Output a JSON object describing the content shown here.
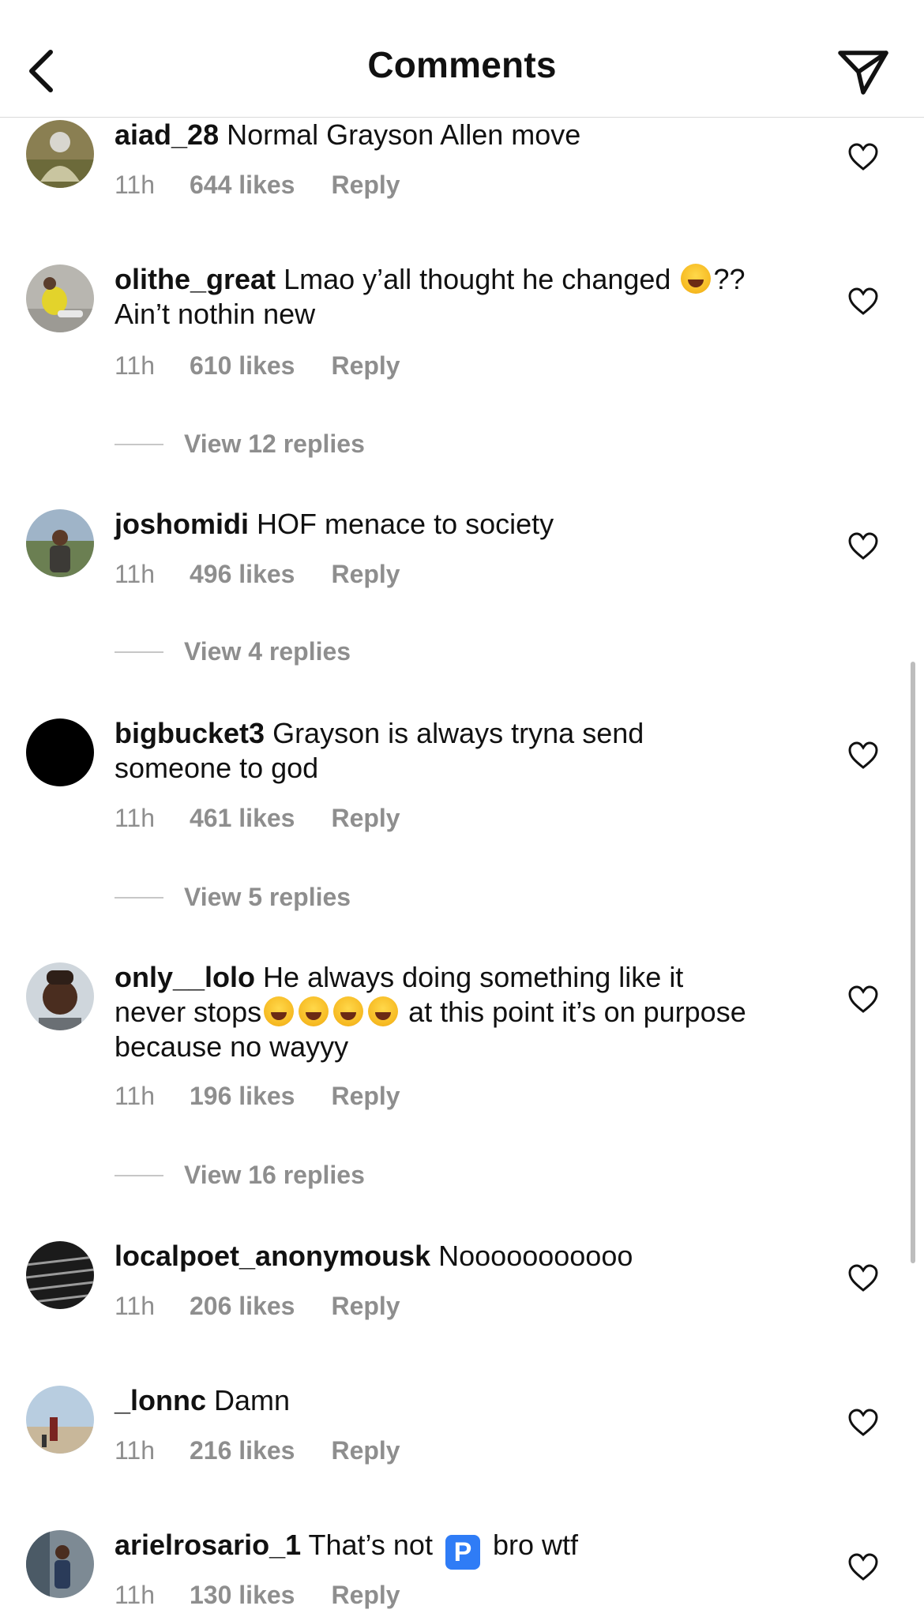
{
  "header": {
    "title": "Comments"
  },
  "comments": [
    {
      "username": "aiad_28",
      "text": "Normal Grayson Allen move",
      "time": "11h",
      "likes": "644 likes",
      "reply": "Reply"
    },
    {
      "username": "olithe_great",
      "text_before_emoji": "Lmao y’all thought he changed ",
      "text_after_emoji": "?? Ain’t nothin new",
      "emoji": "face-with-tears-of-joy",
      "time": "11h",
      "likes": "610 likes",
      "reply": "Reply",
      "view_replies": "View 12 replies"
    },
    {
      "username": "joshomidi",
      "text": "HOF menace to society",
      "time": "11h",
      "likes": "496 likes",
      "reply": "Reply",
      "view_replies": "View 4 replies"
    },
    {
      "username": "bigbucket3",
      "text": "Grayson is always tryna send someone to god",
      "time": "11h",
      "likes": "461 likes",
      "reply": "Reply",
      "view_replies": "View 5 replies"
    },
    {
      "username": "only__lolo",
      "text_before_emoji": "He always doing something like it never stops",
      "emoji": "rolling-on-the-floor-laughing",
      "emoji_count": 4,
      "text_after_emoji": " at this point it’s on purpose because no wayyy",
      "time": "11h",
      "likes": "196 likes",
      "reply": "Reply",
      "view_replies": "View 16 replies"
    },
    {
      "username": "localpoet_anonymousk",
      "text": "Nooooooooooo",
      "time": "11h",
      "likes": "206 likes",
      "reply": "Reply"
    },
    {
      "username": "_lonnc",
      "text": "Damn",
      "time": "11h",
      "likes": "216 likes",
      "reply": "Reply"
    },
    {
      "username": "arielrosario_1",
      "text_before_emoji": "That’s not ",
      "emoji": "P-button",
      "emoji_glyph": "P",
      "text_after_emoji": " bro wtf",
      "time": "11h",
      "likes": "130 likes",
      "reply": "Reply"
    }
  ],
  "colors": {
    "text_primary": "#111111",
    "text_secondary": "#8e8e8e",
    "divider": "#dbdbdb",
    "scrollbar": "#bdbdbd"
  }
}
